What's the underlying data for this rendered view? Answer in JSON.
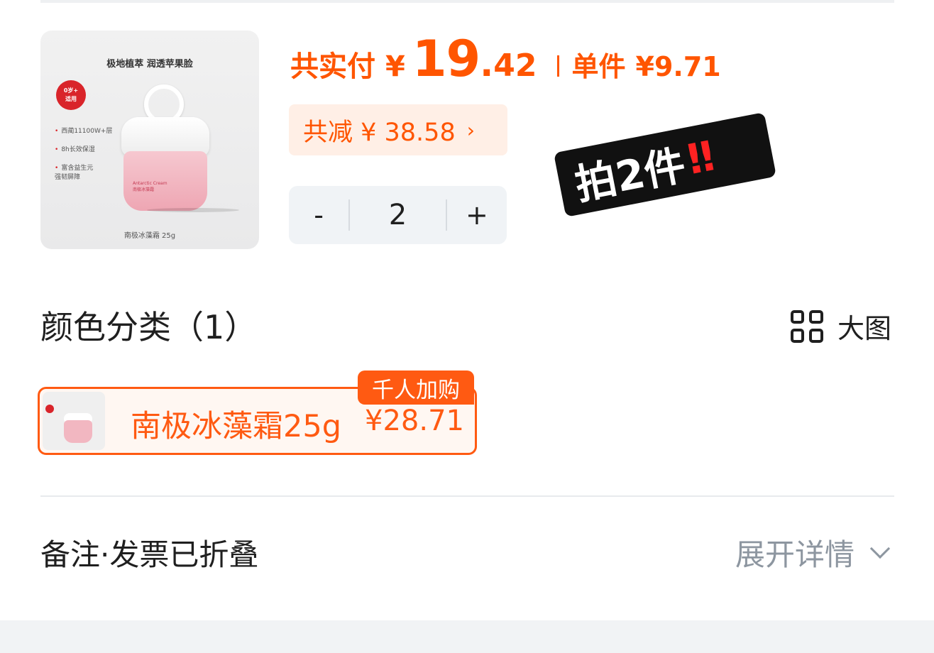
{
  "product_image": {
    "title": "极地植萃 润透苹果脸",
    "badge": "0岁+\n适用",
    "bullets": [
      "西蔺11100W+层",
      "8h长效保湿",
      "富含益生元\n强韧屏障"
    ],
    "jar_label": "Antarctic Cream\n南极冰藻霜",
    "caption": "南极冰藻霜 25g"
  },
  "price": {
    "label": "共实付",
    "currency": "¥",
    "integer": "19",
    "dot": ".",
    "decimal": "42",
    "unit_label": "单件",
    "unit_price": "¥9.71"
  },
  "discount": {
    "text": "共减 ¥ 38.58",
    "chevron": "›"
  },
  "quantity": {
    "minus": "-",
    "value": "2",
    "plus": "+"
  },
  "sticker": {
    "text": "拍2件",
    "emphasis": "‼"
  },
  "color_section": {
    "title": "颜色分类（1）",
    "big_image_label": "大图",
    "options": [
      {
        "name": "南极冰藻霜25g",
        "price": "¥28.71",
        "tag": "千人加购"
      }
    ]
  },
  "notes": {
    "label": "备注·发票已折叠",
    "expand_label": "展开详情"
  },
  "colors": {
    "accent": "#ff5500",
    "accent_soft": "#ffefe6",
    "muted": "#8d96a0",
    "sticker_bg": "#111111"
  }
}
